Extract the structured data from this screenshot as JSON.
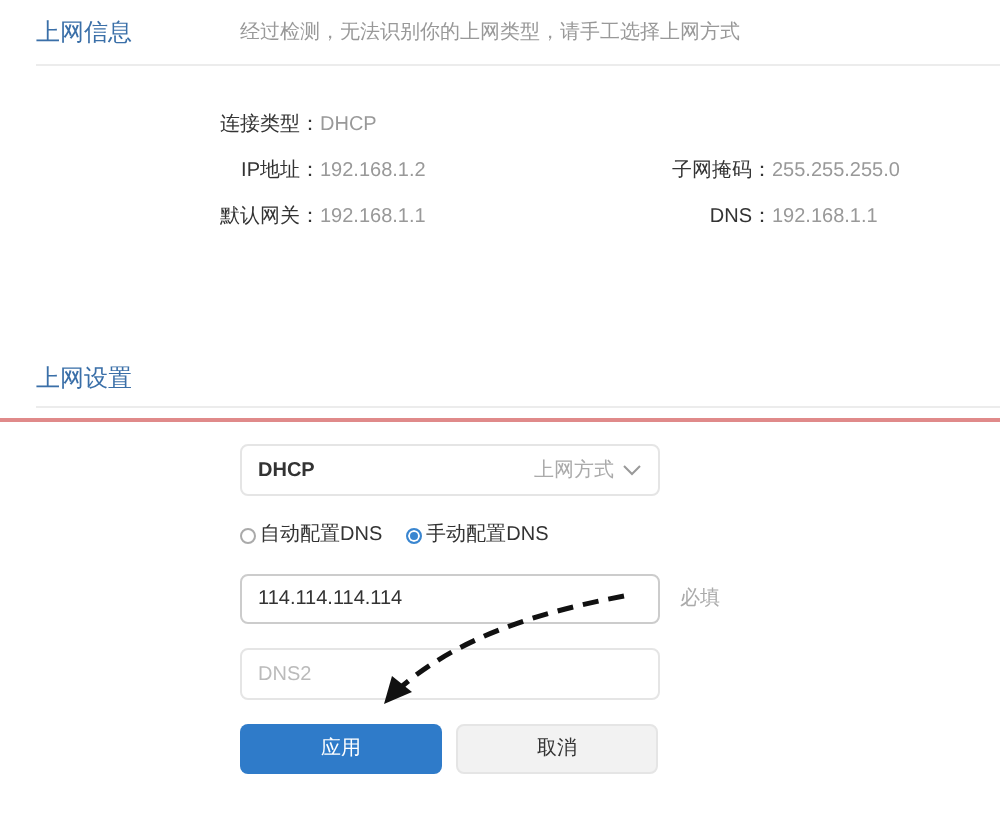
{
  "info_section": {
    "title": "上网信息",
    "description": "经过检测，无法识别你的上网类型，请手工选择上网方式",
    "connection_type": {
      "label": "连接类型：",
      "value": "DHCP"
    },
    "fields": [
      {
        "label": "IP地址：",
        "value": "192.168.1.2"
      },
      {
        "label": "子网掩码：",
        "value": "255.255.255.0"
      },
      {
        "label": "默认网关：",
        "value": "192.168.1.1"
      },
      {
        "label": "DNS：",
        "value": "192.168.1.1"
      }
    ]
  },
  "settings_section": {
    "title": "上网设置",
    "mode_select": {
      "value": "DHCP",
      "label": "上网方式"
    },
    "dns_options": [
      {
        "label": "自动配置DNS",
        "selected": false
      },
      {
        "label": "手动配置DNS",
        "selected": true
      }
    ],
    "dns1": {
      "value": "114.114.114.114",
      "hint": "必填"
    },
    "dns2": {
      "placeholder": "DNS2"
    },
    "buttons": [
      {
        "label": "应用",
        "kind": "primary"
      },
      {
        "label": "取消",
        "kind": "secondary"
      }
    ]
  }
}
